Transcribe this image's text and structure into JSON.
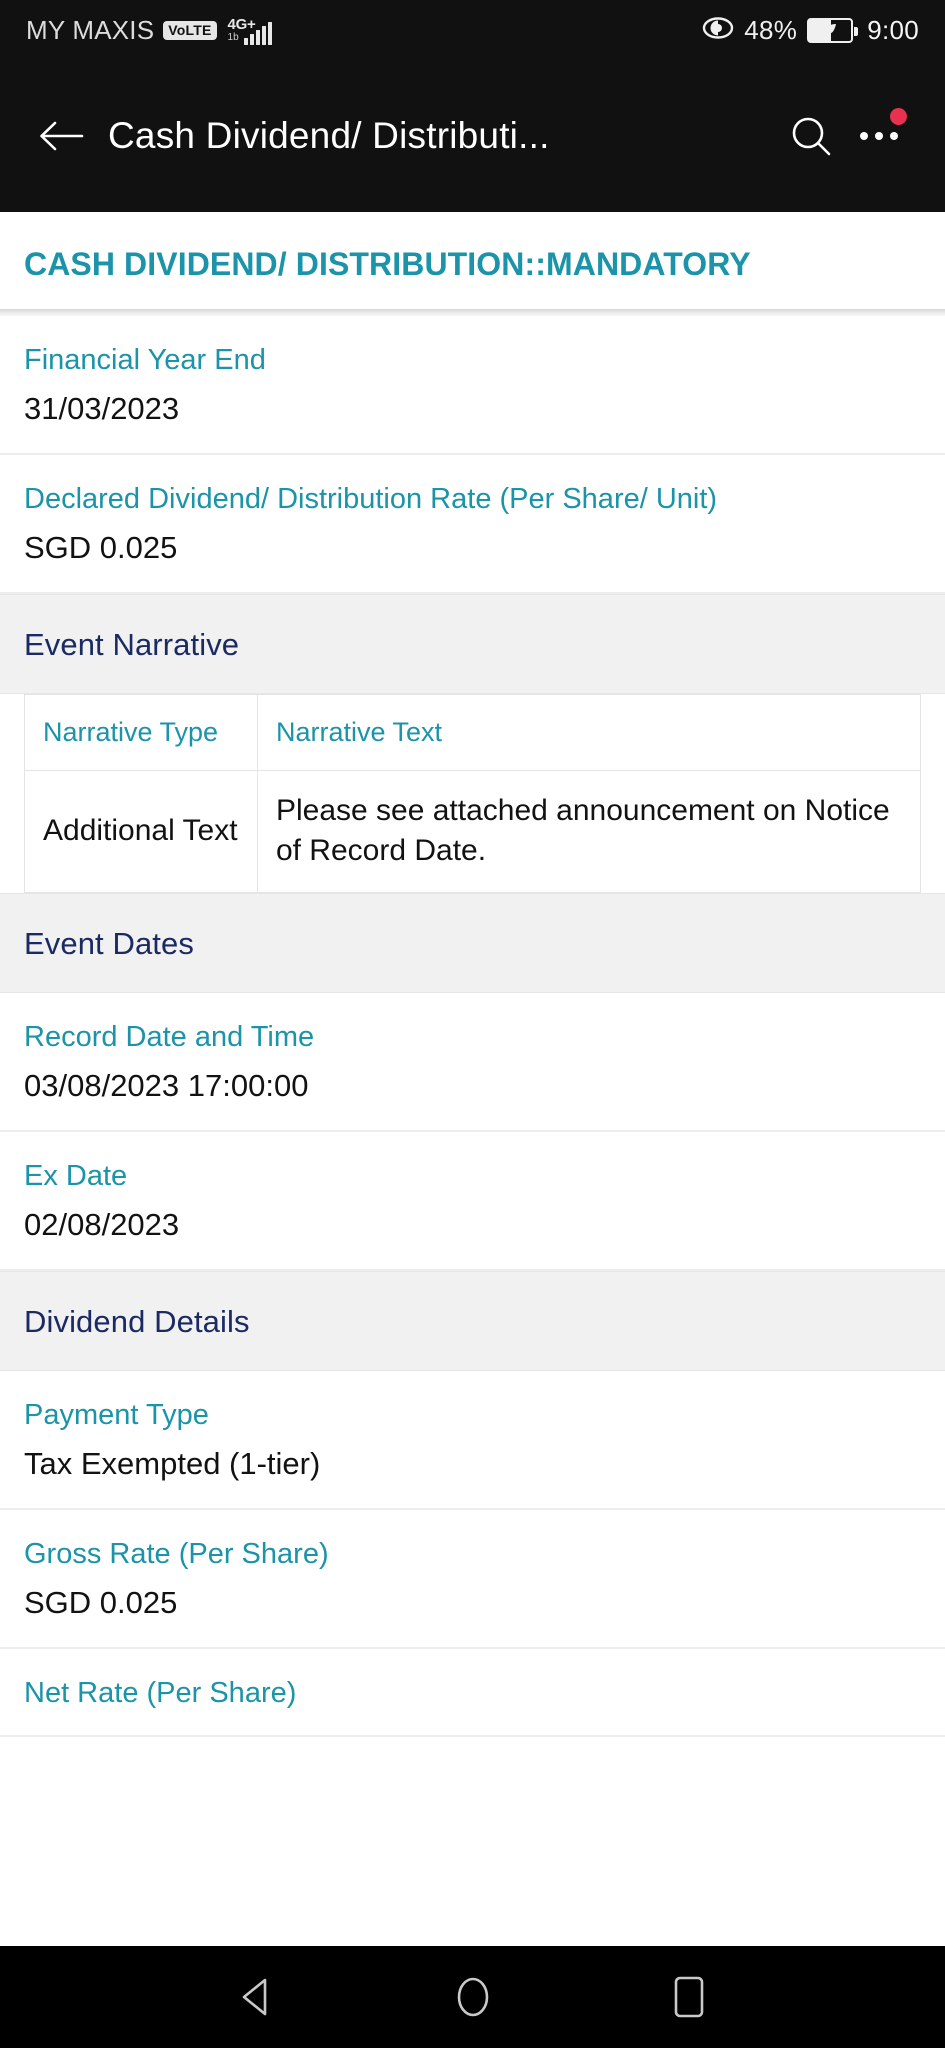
{
  "status_bar": {
    "carrier": "MY MAXIS",
    "volte_badge": "VoLTE",
    "network_type": "4G+",
    "network_sub": "1b",
    "signal_icon": "signal-bars-icon",
    "eye_icon": "eye-comfort-icon",
    "battery_percent": "48%",
    "battery_icon": "battery-power-saving-icon",
    "time": "9:00"
  },
  "app_bar": {
    "back_icon": "back-arrow-icon",
    "title": "Cash Dividend/ Distributi...",
    "search_icon": "search-icon",
    "more_icon": "overflow-menu-icon",
    "badge": ""
  },
  "page": {
    "title": "CASH DIVIDEND/ DISTRIBUTION::MANDATORY",
    "accent_color": "#1b93a9",
    "section_color": "#1b2a63",
    "section_bg": "#f1f1f1"
  },
  "fields_top": [
    {
      "label": "Financial Year End",
      "value": "31/03/2023"
    },
    {
      "label": "Declared Dividend/ Distribution Rate (Per Share/ Unit)",
      "value": "SGD 0.025"
    }
  ],
  "event_narrative": {
    "section_title": "Event Narrative",
    "columns": [
      "Narrative Type",
      "Narrative Text"
    ],
    "rows": [
      [
        "Additional Text",
        "Please see attached announcement on Notice of Record Date."
      ]
    ]
  },
  "event_dates": {
    "section_title": "Event Dates",
    "fields": [
      {
        "label": "Record Date and Time",
        "value": "03/08/2023 17:00:00"
      },
      {
        "label": "Ex Date",
        "value": "02/08/2023"
      }
    ]
  },
  "dividend_details": {
    "section_title": "Dividend Details",
    "fields": [
      {
        "label": "Payment Type",
        "value": "Tax Exempted (1-tier)"
      },
      {
        "label": "Gross Rate (Per Share)",
        "value": "SGD 0.025"
      },
      {
        "label": "Net Rate (Per Share)",
        "value": ""
      }
    ]
  },
  "nav_bar": {
    "back": "nav-back-icon",
    "home": "nav-home-icon",
    "recents": "nav-recents-icon"
  }
}
